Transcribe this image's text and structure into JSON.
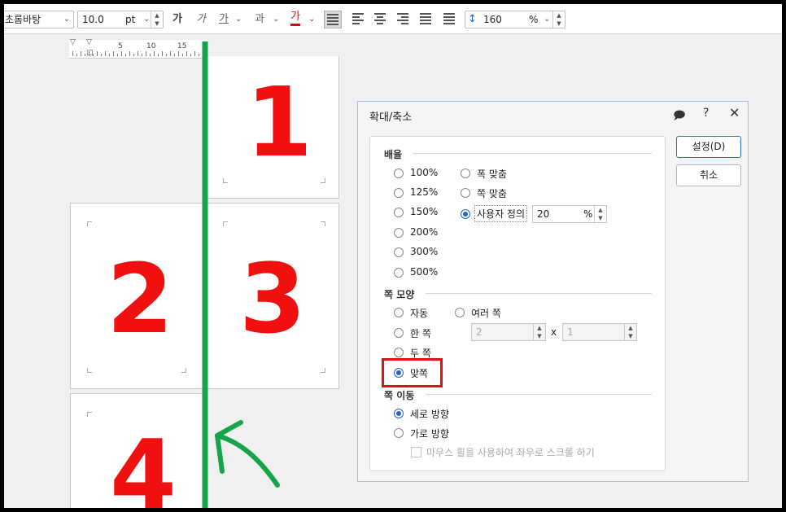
{
  "toolbar": {
    "font_name": "초롬바탕",
    "font_size": "10.0",
    "font_unit": "pt",
    "bold_glyph": "가",
    "italic_glyph": "가",
    "underline_glyph": "가",
    "strike_glyph": "과",
    "color_glyph": "가",
    "line_spacing": "160",
    "line_spacing_unit": "%"
  },
  "ruler": {
    "marks": [
      "5",
      "10",
      "15"
    ]
  },
  "pages": [
    {
      "label": "1"
    },
    {
      "label": "2"
    },
    {
      "label": "3"
    },
    {
      "label": "4"
    }
  ],
  "dialog": {
    "title": "확대/축소",
    "ok_label": "설정(D)",
    "cancel_label": "취소",
    "section_zoom": "배율",
    "zoom_options": [
      "100%",
      "125%",
      "150%",
      "200%",
      "300%",
      "500%"
    ],
    "fit_width": "폭 맞춤",
    "fit_page": "쪽 맞춤",
    "custom": "사용자 정의",
    "custom_value": "20",
    "custom_unit": "%",
    "section_shape": "쪽 모양",
    "shape_auto": "자동",
    "shape_multi": "여러 쪽",
    "shape_one": "한 쪽",
    "shape_two": "두 쪽",
    "shape_facing": "맞쪽",
    "multi_rows": "2",
    "multi_x": "x",
    "multi_cols": "1",
    "section_move": "쪽 이동",
    "move_vertical": "세로 방향",
    "move_horizontal": "가로 방향",
    "mouse_wheel": "마우스 휠을 사용하여 좌우로 스크롤 하기"
  },
  "colors": {
    "annotation_green": "#16a34a",
    "handwriting_red": "#f01010",
    "highlight_red": "#e01010",
    "radio_blue": "#2563c9"
  }
}
